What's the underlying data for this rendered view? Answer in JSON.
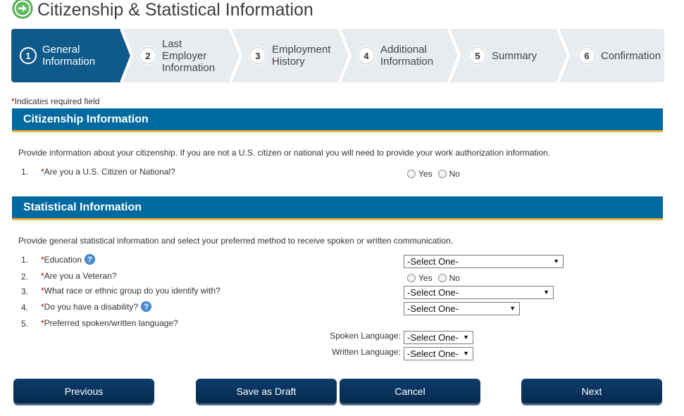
{
  "page": {
    "title": "Citizenship & Statistical Information",
    "title_icon": "arrow-right-circle-icon"
  },
  "wizard": {
    "steps": [
      {
        "number": "1",
        "label": "General\nInformation",
        "active": true
      },
      {
        "number": "2",
        "label": "Last\nEmployer\nInformation",
        "active": false
      },
      {
        "number": "3",
        "label": "Employment\nHistory",
        "active": false
      },
      {
        "number": "4",
        "label": "Additional\nInformation",
        "active": false
      },
      {
        "number": "5",
        "label": "Summary",
        "active": false
      },
      {
        "number": "6",
        "label": "Confirmation",
        "active": false
      }
    ]
  },
  "required_note": {
    "star": "*",
    "text": "Indicates required field"
  },
  "citizenship": {
    "header": "Citizenship Information",
    "description": "Provide information about your citizenship. If you are not a U.S. citizen or national you will need to provide your work authorization information.",
    "questions": [
      {
        "number": "1.",
        "star": "*",
        "text": "Are you a U.S. Citizen or National?",
        "options": [
          "Yes",
          "No"
        ]
      }
    ]
  },
  "statistical": {
    "header": "Statistical Information",
    "description": "Provide general statistical information and select your preferred method to receive spoken or written communication.",
    "questions": [
      {
        "number": "1.",
        "star": "*",
        "text": "Education",
        "select_value": "-Select One-"
      },
      {
        "number": "2.",
        "star": "*",
        "text": "Are you a Veteran?",
        "options": [
          "Yes",
          "No"
        ]
      },
      {
        "number": "3.",
        "star": "*",
        "text": "What race or ethnic group do you identify with?",
        "select_value": "-Select One-"
      },
      {
        "number": "4.",
        "star": "*",
        "text": "Do you have a disability?",
        "select_value": "-Select One-"
      },
      {
        "number": "5.",
        "star": "*",
        "text": "Preferred spoken/written language?"
      }
    ],
    "spoken_language": {
      "label": "Spoken Language:",
      "value": "-Select One-"
    },
    "written_language": {
      "label": "Written Language:",
      "value": "-Select One-"
    }
  },
  "buttons": {
    "previous": "Previous",
    "save_draft": "Save as Draft",
    "cancel": "Cancel",
    "next": "Next"
  },
  "colors": {
    "section_header": "#006aa0",
    "section_underline": "#f2b330",
    "wizard_active": "#0e5a8a",
    "wizard_bg": "#e9ecef",
    "button": "#0a3560",
    "required": "#cc0000",
    "help_icon": "#4a8fd6",
    "title_icon": "#5cb85c"
  }
}
